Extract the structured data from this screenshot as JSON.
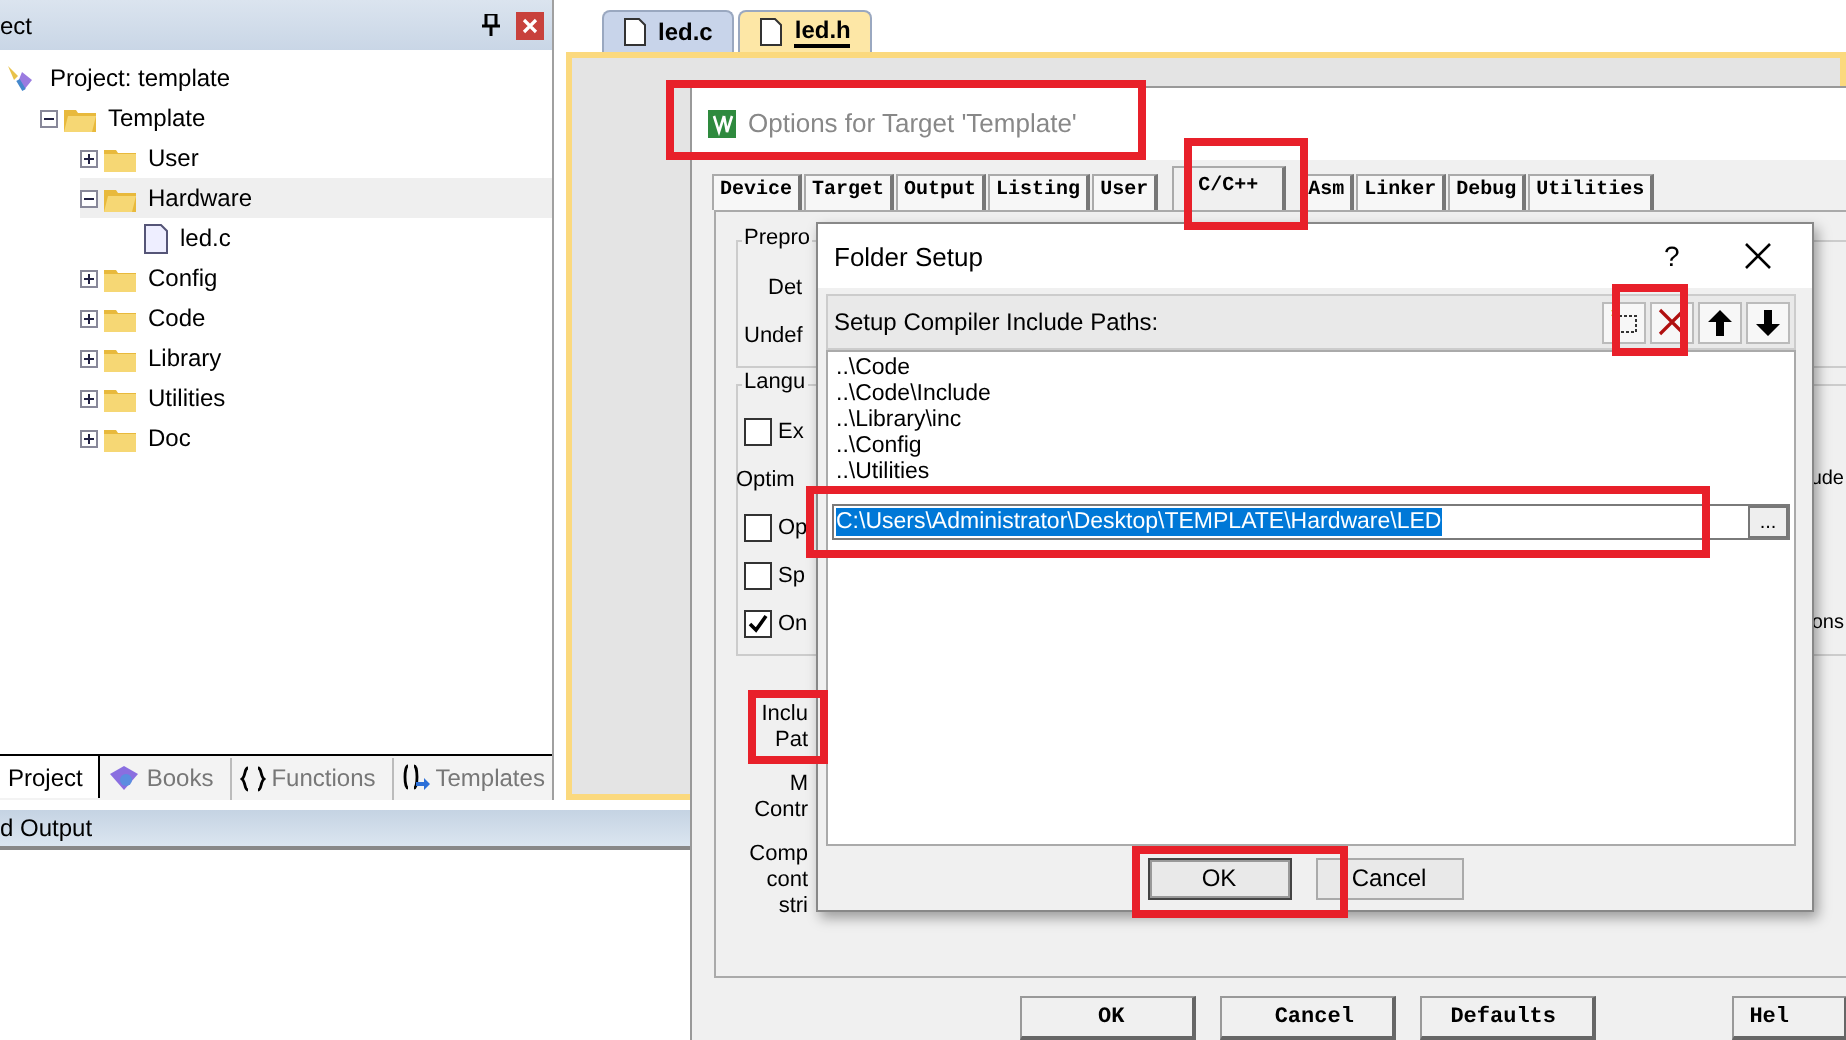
{
  "project_panel": {
    "title": "ect",
    "tree": [
      {
        "label": "Project: template",
        "kind": "project",
        "selected": false,
        "children": [
          {
            "label": "Template",
            "kind": "target",
            "expanded": true,
            "selected": false,
            "children": [
              {
                "label": "User",
                "kind": "folder",
                "expanded": false,
                "selected": false
              },
              {
                "label": "Hardware",
                "kind": "folder",
                "expanded": true,
                "selected": true,
                "children": [
                  {
                    "label": "led.c",
                    "kind": "file",
                    "selected": false
                  }
                ]
              },
              {
                "label": "Config",
                "kind": "folder",
                "expanded": false,
                "selected": false
              },
              {
                "label": "Code",
                "kind": "folder",
                "expanded": false,
                "selected": false
              },
              {
                "label": "Library",
                "kind": "folder",
                "expanded": false,
                "selected": false
              },
              {
                "label": "Utilities",
                "kind": "folder",
                "expanded": false,
                "selected": false
              },
              {
                "label": "Doc",
                "kind": "folder",
                "expanded": false,
                "selected": false
              }
            ]
          }
        ]
      }
    ],
    "tabs": [
      {
        "label": "Project",
        "kind": "project",
        "selected": true
      },
      {
        "label": "Books",
        "kind": "books",
        "selected": false
      },
      {
        "label": "Functions",
        "kind": "functions",
        "selected": false
      },
      {
        "label": "Templates",
        "kind": "templates",
        "selected": false
      }
    ]
  },
  "output_panel": {
    "title": "d Output"
  },
  "editor": {
    "tabs": [
      {
        "label": "led.c",
        "selected": false
      },
      {
        "label": "led.h",
        "selected": true
      }
    ]
  },
  "options_dialog": {
    "title": "Options for Target 'Template'",
    "tabs": [
      {
        "label": "Device",
        "selected": false
      },
      {
        "label": "Target",
        "selected": false
      },
      {
        "label": "Output",
        "selected": false
      },
      {
        "label": "Listing",
        "selected": false
      },
      {
        "label": "User",
        "selected": false
      },
      {
        "label": "C/C++",
        "selected": true
      },
      {
        "label": "Asm",
        "selected": false
      },
      {
        "label": "Linker",
        "selected": false
      },
      {
        "label": "Debug",
        "selected": false
      },
      {
        "label": "Utilities",
        "selected": false
      }
    ],
    "preprocessor": {
      "title": "Prepro",
      "fields": [
        "Det",
        "Undef"
      ]
    },
    "language": {
      "title": "Langu",
      "rows": [
        {
          "kind": "checkbox",
          "label": "Ex",
          "checked": false
        },
        {
          "kind": "label",
          "label": "Optim",
          "side": "ude"
        },
        {
          "kind": "checkbox",
          "label": "Op",
          "checked": false
        },
        {
          "kind": "checkbox",
          "label": "Sp",
          "checked": false
        },
        {
          "kind": "checkbox",
          "label": "On",
          "checked": true,
          "side": "ons"
        }
      ]
    },
    "labels": [
      [
        "Inclu",
        "Pat"
      ],
      [
        "M",
        "Contr"
      ],
      [
        "Comp",
        "cont",
        "stri"
      ]
    ],
    "buttons": [
      "OK",
      "Cancel",
      "Defaults",
      "Hel"
    ]
  },
  "folder_dialog": {
    "title": "Folder Setup",
    "help": "?",
    "heading": "Setup Compiler Include Paths:",
    "paths": [
      "..\\Code",
      "..\\Code\\Include",
      "..\\Library\\inc",
      "..\\Config",
      "..\\Utilities"
    ],
    "edit_value": "C:\\Users\\Administrator\\Desktop\\TEMPLATE\\Hardware\\LED",
    "browse": "...",
    "buttons": [
      {
        "label": "OK",
        "default": true
      },
      {
        "label": "Cancel",
        "default": false
      }
    ]
  }
}
